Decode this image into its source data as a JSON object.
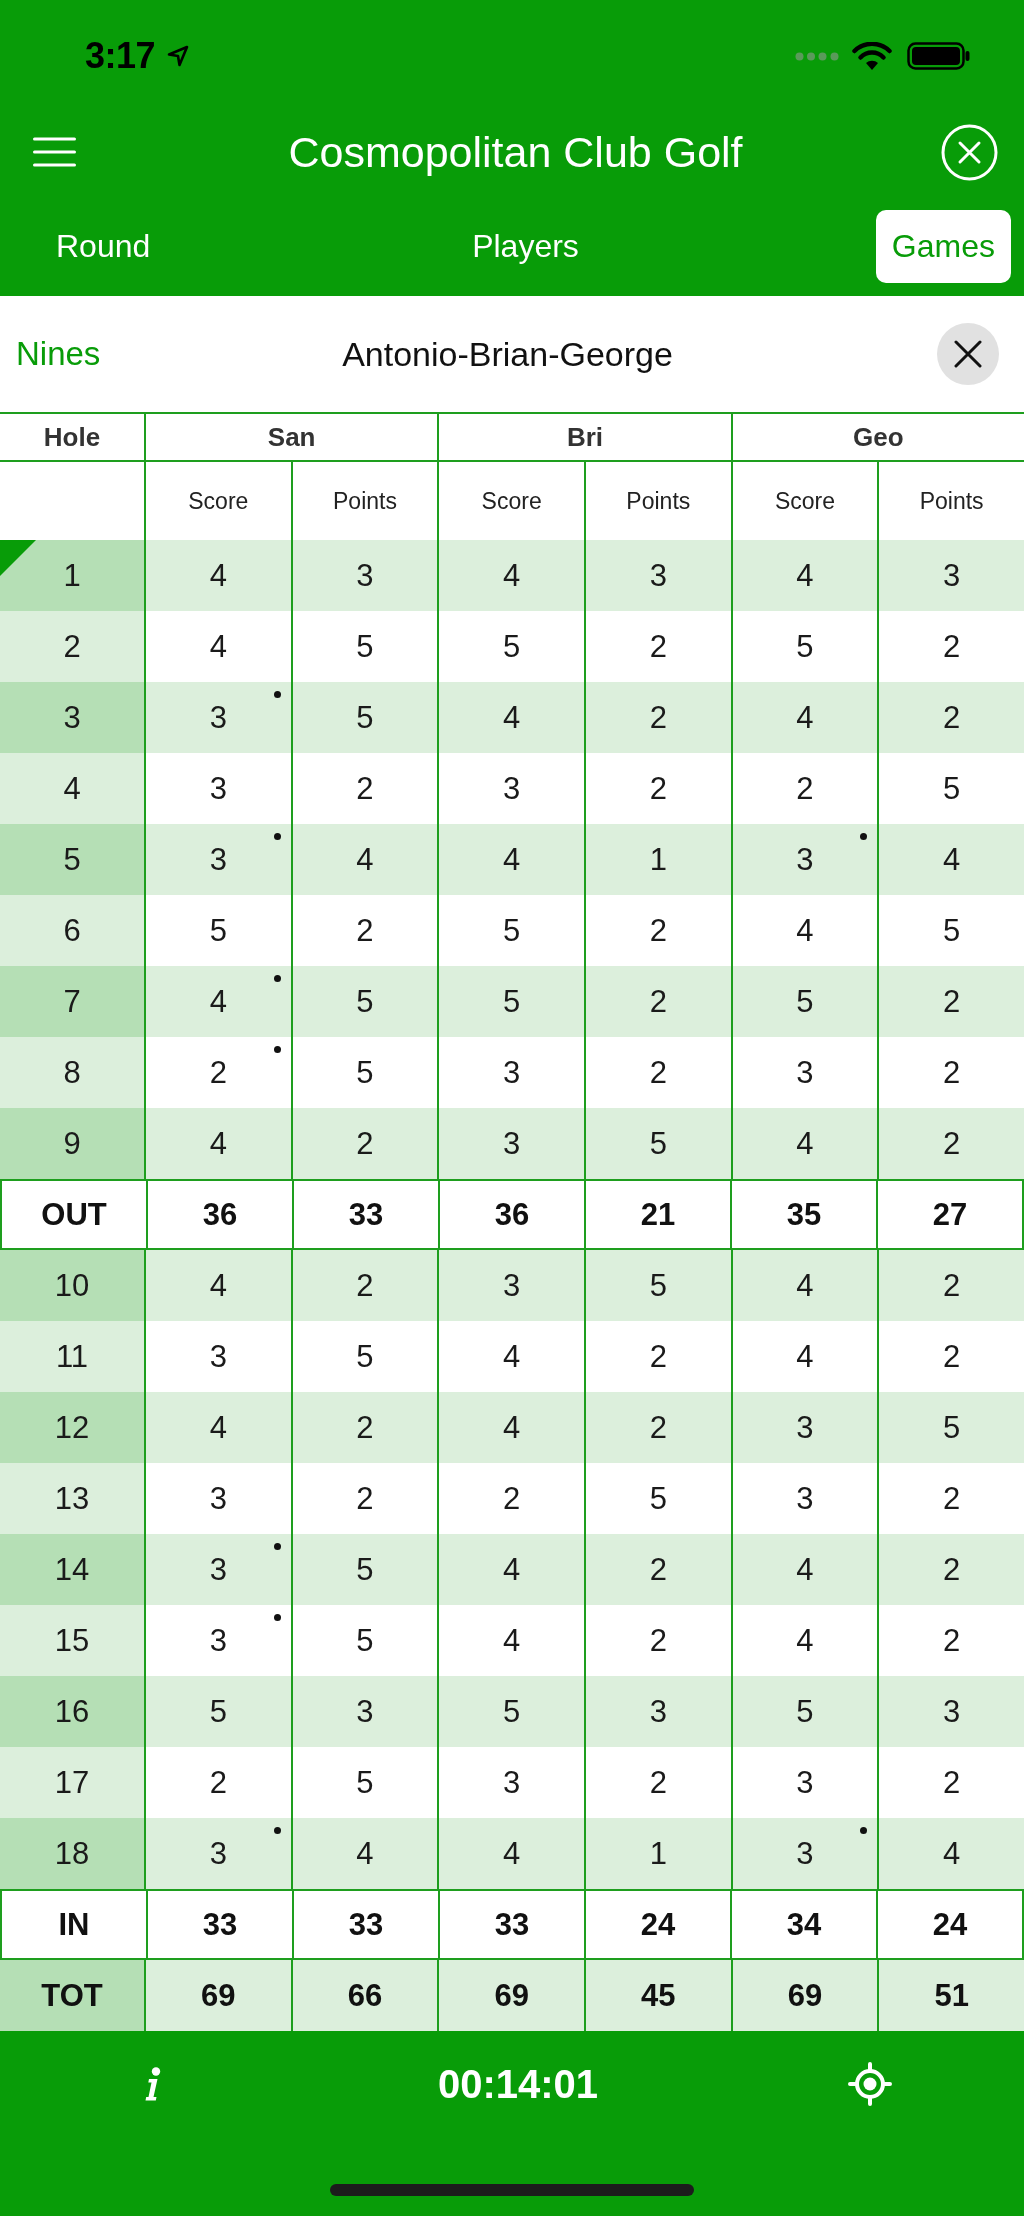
{
  "status_bar": {
    "time": "3:17"
  },
  "header": {
    "title": "Cosmopolitan Club Golf"
  },
  "tabs": [
    {
      "label": "Round",
      "selected": false
    },
    {
      "label": "Players",
      "selected": false
    },
    {
      "label": "Games",
      "selected": true
    }
  ],
  "game": {
    "label": "Nines",
    "players": "Antonio-Brian-George"
  },
  "table": {
    "hole_heading": "Hole",
    "players": [
      {
        "name": "San",
        "columns": [
          "Score",
          "Points"
        ]
      },
      {
        "name": "Bri",
        "columns": [
          "Score",
          "Points"
        ]
      },
      {
        "name": "Geo",
        "columns": [
          "Score",
          "Points"
        ]
      }
    ],
    "rows": [
      {
        "kind": "hole",
        "label": "1",
        "current": true,
        "cells": [
          {
            "value": "4",
            "dot": false
          },
          {
            "value": "3",
            "dot": false
          },
          {
            "value": "4",
            "dot": false
          },
          {
            "value": "3",
            "dot": false
          },
          {
            "value": "4",
            "dot": false
          },
          {
            "value": "3",
            "dot": false
          }
        ]
      },
      {
        "kind": "hole",
        "label": "2",
        "current": false,
        "cells": [
          {
            "value": "4",
            "dot": false
          },
          {
            "value": "5",
            "dot": false
          },
          {
            "value": "5",
            "dot": false
          },
          {
            "value": "2",
            "dot": false
          },
          {
            "value": "5",
            "dot": false
          },
          {
            "value": "2",
            "dot": false
          }
        ]
      },
      {
        "kind": "hole",
        "label": "3",
        "current": false,
        "cells": [
          {
            "value": "3",
            "dot": true
          },
          {
            "value": "5",
            "dot": false
          },
          {
            "value": "4",
            "dot": false
          },
          {
            "value": "2",
            "dot": false
          },
          {
            "value": "4",
            "dot": false
          },
          {
            "value": "2",
            "dot": false
          }
        ]
      },
      {
        "kind": "hole",
        "label": "4",
        "current": false,
        "cells": [
          {
            "value": "3",
            "dot": false
          },
          {
            "value": "2",
            "dot": false
          },
          {
            "value": "3",
            "dot": false
          },
          {
            "value": "2",
            "dot": false
          },
          {
            "value": "2",
            "dot": false
          },
          {
            "value": "5",
            "dot": false
          }
        ]
      },
      {
        "kind": "hole",
        "label": "5",
        "current": false,
        "cells": [
          {
            "value": "3",
            "dot": true
          },
          {
            "value": "4",
            "dot": false
          },
          {
            "value": "4",
            "dot": false
          },
          {
            "value": "1",
            "dot": false
          },
          {
            "value": "3",
            "dot": true
          },
          {
            "value": "4",
            "dot": false
          }
        ]
      },
      {
        "kind": "hole",
        "label": "6",
        "current": false,
        "cells": [
          {
            "value": "5",
            "dot": false
          },
          {
            "value": "2",
            "dot": false
          },
          {
            "value": "5",
            "dot": false
          },
          {
            "value": "2",
            "dot": false
          },
          {
            "value": "4",
            "dot": false
          },
          {
            "value": "5",
            "dot": false
          }
        ]
      },
      {
        "kind": "hole",
        "label": "7",
        "current": false,
        "cells": [
          {
            "value": "4",
            "dot": true
          },
          {
            "value": "5",
            "dot": false
          },
          {
            "value": "5",
            "dot": false
          },
          {
            "value": "2",
            "dot": false
          },
          {
            "value": "5",
            "dot": false
          },
          {
            "value": "2",
            "dot": false
          }
        ]
      },
      {
        "kind": "hole",
        "label": "8",
        "current": false,
        "cells": [
          {
            "value": "2",
            "dot": true
          },
          {
            "value": "5",
            "dot": false
          },
          {
            "value": "3",
            "dot": false
          },
          {
            "value": "2",
            "dot": false
          },
          {
            "value": "3",
            "dot": false
          },
          {
            "value": "2",
            "dot": false
          }
        ]
      },
      {
        "kind": "hole",
        "label": "9",
        "current": false,
        "cells": [
          {
            "value": "4",
            "dot": false
          },
          {
            "value": "2",
            "dot": false
          },
          {
            "value": "3",
            "dot": false
          },
          {
            "value": "5",
            "dot": false
          },
          {
            "value": "4",
            "dot": false
          },
          {
            "value": "2",
            "dot": false
          }
        ]
      },
      {
        "kind": "subtotal",
        "label": "OUT",
        "current": false,
        "cells": [
          {
            "value": "36",
            "dot": false
          },
          {
            "value": "33",
            "dot": false
          },
          {
            "value": "36",
            "dot": false
          },
          {
            "value": "21",
            "dot": false
          },
          {
            "value": "35",
            "dot": false
          },
          {
            "value": "27",
            "dot": false
          }
        ]
      },
      {
        "kind": "hole",
        "label": "10",
        "current": false,
        "cells": [
          {
            "value": "4",
            "dot": false
          },
          {
            "value": "2",
            "dot": false
          },
          {
            "value": "3",
            "dot": false
          },
          {
            "value": "5",
            "dot": false
          },
          {
            "value": "4",
            "dot": false
          },
          {
            "value": "2",
            "dot": false
          }
        ]
      },
      {
        "kind": "hole",
        "label": "11",
        "current": false,
        "cells": [
          {
            "value": "3",
            "dot": false
          },
          {
            "value": "5",
            "dot": false
          },
          {
            "value": "4",
            "dot": false
          },
          {
            "value": "2",
            "dot": false
          },
          {
            "value": "4",
            "dot": false
          },
          {
            "value": "2",
            "dot": false
          }
        ]
      },
      {
        "kind": "hole",
        "label": "12",
        "current": false,
        "cells": [
          {
            "value": "4",
            "dot": false
          },
          {
            "value": "2",
            "dot": false
          },
          {
            "value": "4",
            "dot": false
          },
          {
            "value": "2",
            "dot": false
          },
          {
            "value": "3",
            "dot": false
          },
          {
            "value": "5",
            "dot": false
          }
        ]
      },
      {
        "kind": "hole",
        "label": "13",
        "current": false,
        "cells": [
          {
            "value": "3",
            "dot": false
          },
          {
            "value": "2",
            "dot": false
          },
          {
            "value": "2",
            "dot": false
          },
          {
            "value": "5",
            "dot": false
          },
          {
            "value": "3",
            "dot": false
          },
          {
            "value": "2",
            "dot": false
          }
        ]
      },
      {
        "kind": "hole",
        "label": "14",
        "current": false,
        "cells": [
          {
            "value": "3",
            "dot": true
          },
          {
            "value": "5",
            "dot": false
          },
          {
            "value": "4",
            "dot": false
          },
          {
            "value": "2",
            "dot": false
          },
          {
            "value": "4",
            "dot": false
          },
          {
            "value": "2",
            "dot": false
          }
        ]
      },
      {
        "kind": "hole",
        "label": "15",
        "current": false,
        "cells": [
          {
            "value": "3",
            "dot": true
          },
          {
            "value": "5",
            "dot": false
          },
          {
            "value": "4",
            "dot": false
          },
          {
            "value": "2",
            "dot": false
          },
          {
            "value": "4",
            "dot": false
          },
          {
            "value": "2",
            "dot": false
          }
        ]
      },
      {
        "kind": "hole",
        "label": "16",
        "current": false,
        "cells": [
          {
            "value": "5",
            "dot": false
          },
          {
            "value": "3",
            "dot": false
          },
          {
            "value": "5",
            "dot": false
          },
          {
            "value": "3",
            "dot": false
          },
          {
            "value": "5",
            "dot": false
          },
          {
            "value": "3",
            "dot": false
          }
        ]
      },
      {
        "kind": "hole",
        "label": "17",
        "current": false,
        "cells": [
          {
            "value": "2",
            "dot": false
          },
          {
            "value": "5",
            "dot": false
          },
          {
            "value": "3",
            "dot": false
          },
          {
            "value": "2",
            "dot": false
          },
          {
            "value": "3",
            "dot": false
          },
          {
            "value": "2",
            "dot": false
          }
        ]
      },
      {
        "kind": "hole",
        "label": "18",
        "current": false,
        "cells": [
          {
            "value": "3",
            "dot": true
          },
          {
            "value": "4",
            "dot": false
          },
          {
            "value": "4",
            "dot": false
          },
          {
            "value": "1",
            "dot": false
          },
          {
            "value": "3",
            "dot": true
          },
          {
            "value": "4",
            "dot": false
          }
        ]
      },
      {
        "kind": "subtotal",
        "label": "IN",
        "current": false,
        "cells": [
          {
            "value": "33",
            "dot": false
          },
          {
            "value": "33",
            "dot": false
          },
          {
            "value": "33",
            "dot": false
          },
          {
            "value": "24",
            "dot": false
          },
          {
            "value": "34",
            "dot": false
          },
          {
            "value": "24",
            "dot": false
          }
        ]
      },
      {
        "kind": "total",
        "label": "TOT",
        "current": false,
        "cells": [
          {
            "value": "69",
            "dot": false
          },
          {
            "value": "66",
            "dot": false
          },
          {
            "value": "69",
            "dot": false
          },
          {
            "value": "45",
            "dot": false
          },
          {
            "value": "69",
            "dot": false
          },
          {
            "value": "51",
            "dot": false
          }
        ]
      }
    ]
  },
  "footer": {
    "timer": "00:14:01"
  }
}
